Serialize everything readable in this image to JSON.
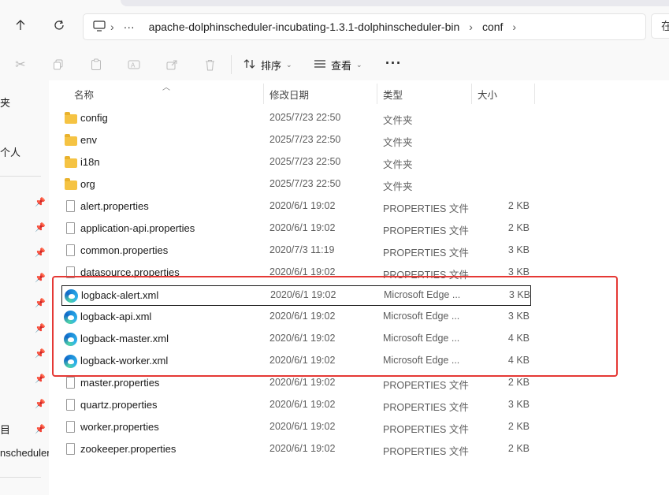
{
  "address_bar": {
    "segments": [
      "apache-dolphinscheduler-incubating-1.3.1-dolphinscheduler-bin",
      "conf"
    ],
    "overflow": "···",
    "search_stub": "在"
  },
  "toolbar": {
    "sort_label": "排序",
    "view_label": "查看",
    "more_label": "···"
  },
  "leftnav": {
    "items": [
      "夹",
      "个人",
      "目",
      "nscheduler"
    ]
  },
  "columns": {
    "name": "名称",
    "date": "修改日期",
    "type": "类型",
    "size": "大小"
  },
  "files": [
    {
      "name": "config",
      "date": "2025/7/23 22:50",
      "type": "文件夹",
      "size": "",
      "icon": "folder-icon"
    },
    {
      "name": "env",
      "date": "2025/7/23 22:50",
      "type": "文件夹",
      "size": "",
      "icon": "folder-icon"
    },
    {
      "name": "i18n",
      "date": "2025/7/23 22:50",
      "type": "文件夹",
      "size": "",
      "icon": "folder-icon"
    },
    {
      "name": "org",
      "date": "2025/7/23 22:50",
      "type": "文件夹",
      "size": "",
      "icon": "folder-icon"
    },
    {
      "name": "alert.properties",
      "date": "2020/6/1 19:02",
      "type": "PROPERTIES 文件",
      "size": "2 KB",
      "icon": "file-icon"
    },
    {
      "name": "application-api.properties",
      "date": "2020/6/1 19:02",
      "type": "PROPERTIES 文件",
      "size": "2 KB",
      "icon": "file-icon"
    },
    {
      "name": "common.properties",
      "date": "2020/7/3 11:19",
      "type": "PROPERTIES 文件",
      "size": "3 KB",
      "icon": "file-icon"
    },
    {
      "name": "datasource.properties",
      "date": "2020/6/1 19:02",
      "type": "PROPERTIES 文件",
      "size": "3 KB",
      "icon": "file-icon"
    },
    {
      "name": "logback-alert.xml",
      "date": "2020/6/1 19:02",
      "type": "Microsoft Edge ...",
      "size": "3 KB",
      "icon": "edge-icon"
    },
    {
      "name": "logback-api.xml",
      "date": "2020/6/1 19:02",
      "type": "Microsoft Edge ...",
      "size": "3 KB",
      "icon": "edge-icon"
    },
    {
      "name": "logback-master.xml",
      "date": "2020/6/1 19:02",
      "type": "Microsoft Edge ...",
      "size": "4 KB",
      "icon": "edge-icon"
    },
    {
      "name": "logback-worker.xml",
      "date": "2020/6/1 19:02",
      "type": "Microsoft Edge ...",
      "size": "4 KB",
      "icon": "edge-icon"
    },
    {
      "name": "master.properties",
      "date": "2020/6/1 19:02",
      "type": "PROPERTIES 文件",
      "size": "2 KB",
      "icon": "file-icon"
    },
    {
      "name": "quartz.properties",
      "date": "2020/6/1 19:02",
      "type": "PROPERTIES 文件",
      "size": "3 KB",
      "icon": "file-icon"
    },
    {
      "name": "worker.properties",
      "date": "2020/6/1 19:02",
      "type": "PROPERTIES 文件",
      "size": "2 KB",
      "icon": "file-icon"
    },
    {
      "name": "zookeeper.properties",
      "date": "2020/6/1 19:02",
      "type": "PROPERTIES 文件",
      "size": "2 KB",
      "icon": "file-icon"
    }
  ],
  "selected_file": "logback-alert.xml",
  "colors": {
    "highlight": "#e53935",
    "folder": "#f5c343",
    "edge": "#1b8ad8"
  }
}
